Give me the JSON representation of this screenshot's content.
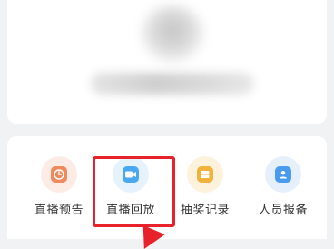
{
  "actions": [
    {
      "label": "直播预告",
      "icon": "clock-icon",
      "color": "#f08a5d",
      "bg": "#fdece5"
    },
    {
      "label": "直播回放",
      "icon": "video-camera-icon",
      "color": "#4aa8f0",
      "bg": "#e6f3fd"
    },
    {
      "label": "抽奖记录",
      "icon": "gift-box-icon",
      "color": "#f2b33d",
      "bg": "#fdf2dc"
    },
    {
      "label": "人员报备",
      "icon": "person-badge-icon",
      "color": "#4a9af0",
      "bg": "#e6f0fd"
    }
  ],
  "highlight": {
    "color": "#e8222b",
    "target": "直播回放"
  }
}
